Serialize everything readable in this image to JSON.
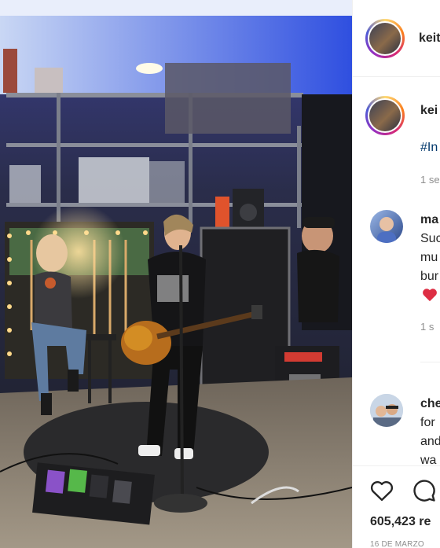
{
  "post": {
    "header_username": "keit",
    "caption_username": "kei",
    "hashtag_fragment": "#In",
    "caption_time": "1 se"
  },
  "comments": [
    {
      "username": "ma",
      "lines": [
        "Suc",
        "mu",
        "bur"
      ],
      "time": "1 s"
    },
    {
      "username": "che",
      "lines": [
        "for",
        "and",
        "wa"
      ]
    }
  ],
  "actions": {
    "like_icon": "heart-outline-icon",
    "comment_icon": "comment-bubble-icon",
    "heart_emoji_icon": "red-heart-emoji-icon"
  },
  "stats": {
    "likes": "605,423 re",
    "date": "16 DE MARZO"
  },
  "colors": {
    "link": "#00376b",
    "muted": "#8e8e8e",
    "heart": "#ed4956"
  }
}
